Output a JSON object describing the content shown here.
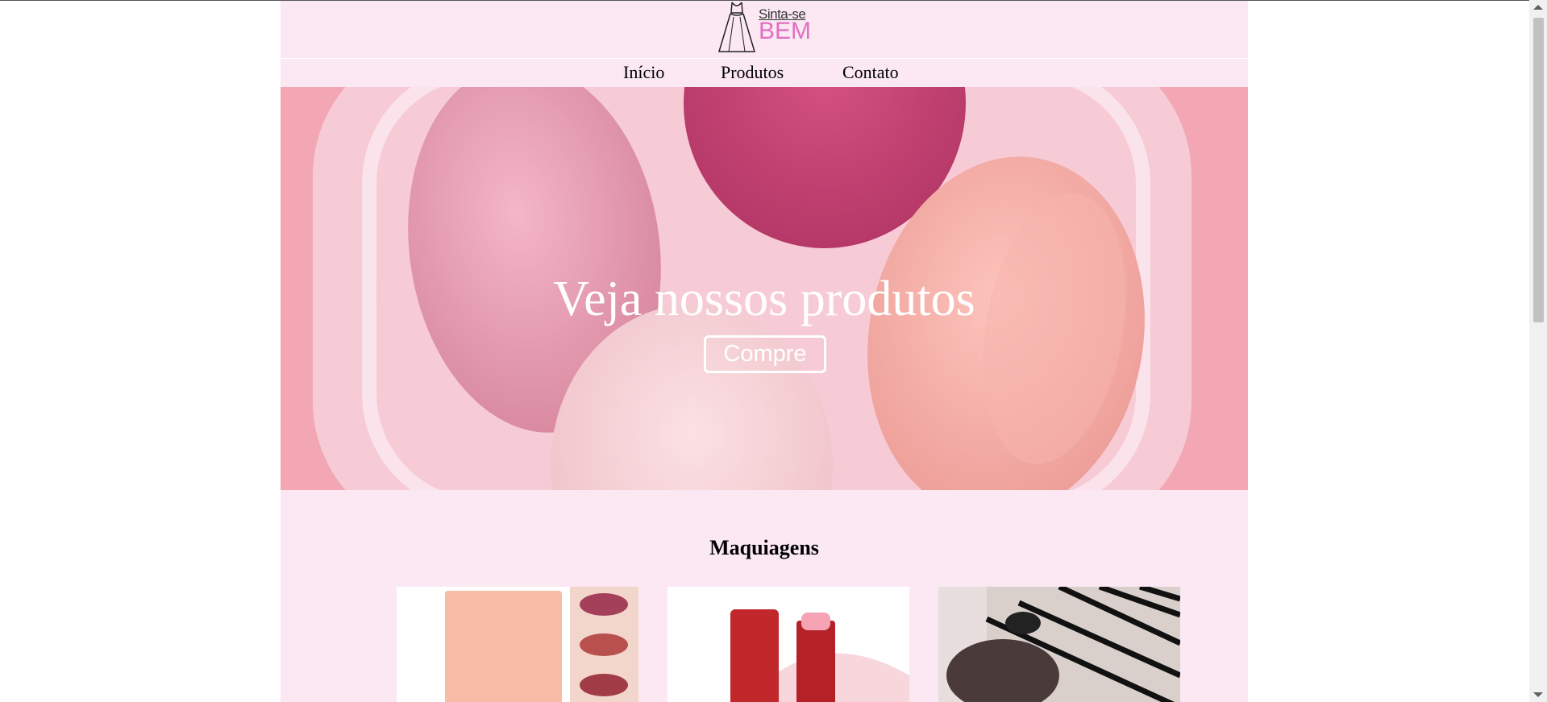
{
  "brand": {
    "logo_top": "Sinta-se",
    "logo_bottom": "BEM"
  },
  "nav": {
    "items": [
      "Início",
      "Produtos",
      "Contato"
    ]
  },
  "hero": {
    "title": "Veja nossos produtos",
    "button_label": "Compre"
  },
  "section": {
    "title": "Maquiagens",
    "products": [
      {
        "name": "lipstick-palette"
      },
      {
        "name": "lip-balm"
      },
      {
        "name": "makeup-brushes"
      }
    ]
  },
  "colors": {
    "background": "#fbe8f3",
    "logo_accent": "#e36ec0",
    "hero_base": "#f2a9b7"
  }
}
